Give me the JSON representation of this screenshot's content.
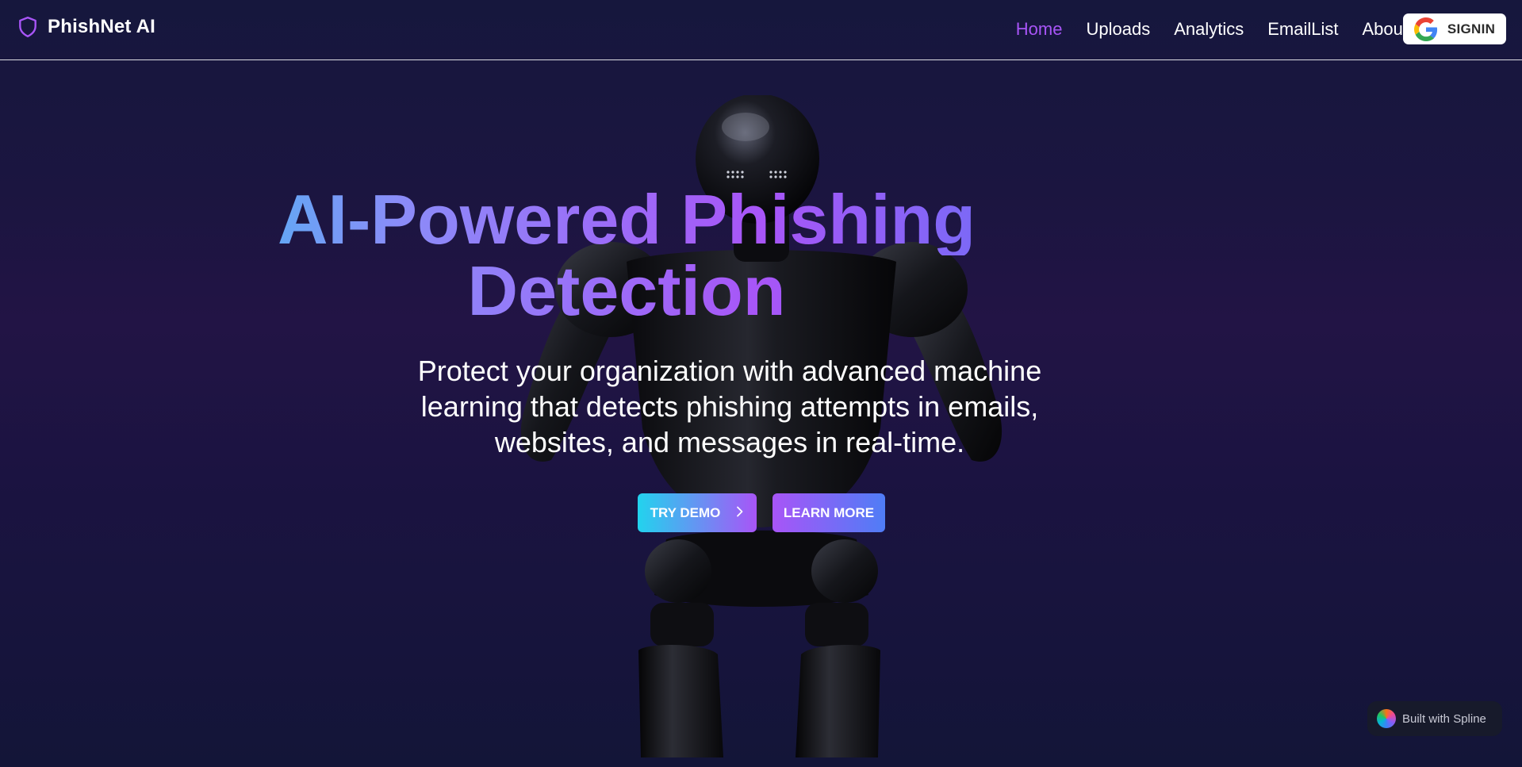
{
  "header": {
    "brand": "PhishNet AI",
    "nav": [
      {
        "label": "Home",
        "active": true
      },
      {
        "label": "Uploads",
        "active": false
      },
      {
        "label": "Analytics",
        "active": false
      },
      {
        "label": "EmailList",
        "active": false
      },
      {
        "label": "About",
        "active": false
      }
    ],
    "signin_label": "SIGNIN"
  },
  "hero": {
    "title_line1": "AI-Powered Phishing",
    "title_line2": "Detection",
    "subtitle_lines": [
      "Protect your organization with advanced machine",
      "learning that detects phishing attempts in emails,",
      "websites, and messages in real-time."
    ],
    "primary_button": "TRY DEMO",
    "secondary_button": "LEARN MORE"
  },
  "badge": {
    "text": "Built with Spline"
  },
  "colors": {
    "accent_purple": "#a855f7",
    "accent_cyan": "#22d3ee",
    "accent_blue": "#4f7df6",
    "background": "#1b1540"
  },
  "icons": [
    "shield-icon",
    "google-icon",
    "chevron-right-icon",
    "spline-logo-icon"
  ]
}
